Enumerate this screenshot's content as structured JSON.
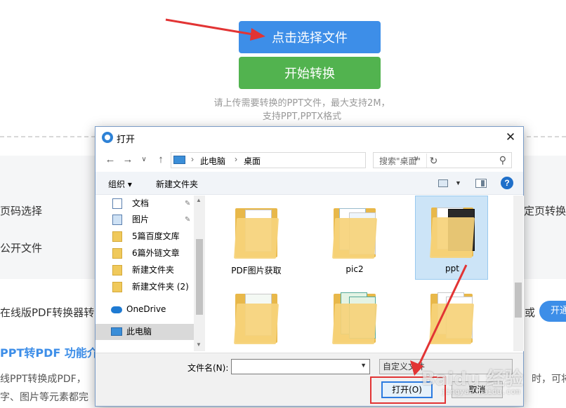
{
  "page": {
    "select_file_button": "点击选择文件",
    "start_convert_button": "开始转换",
    "hint_line1": "请上传需要转换的PPT文件，最大支持2M，",
    "hint_line2": "支持PPT,PPTX格式",
    "page_select_label": "页码选择",
    "open_file_label": "公开文件",
    "specify_page_label": "定页转换",
    "online_text": "在线版PDF转换器转",
    "or_text": "或",
    "open_small_button": "开通",
    "feature_title": "PPT转PDF 功能介",
    "desc_line1": "线PPT转换成PDF，",
    "desc_line2": "字、图片等元素都完",
    "desc_right1": "时，",
    "desc_right2": "可将"
  },
  "dialog": {
    "title": "打开",
    "close_glyph": "✕",
    "nav": {
      "back": "←",
      "forward": "→",
      "recent": "∨",
      "up": "↑",
      "path_root": "此电脑",
      "path_leaf": "桌面",
      "refresh": "↻",
      "search_placeholder": "搜索\"桌面\"",
      "search_icon": "search-icon"
    },
    "toolbar": {
      "organize": "组织 ▾",
      "new_folder": "新建文件夹",
      "help": "?"
    },
    "sidebar": {
      "items": [
        {
          "label": "文档",
          "icon": "document-icon",
          "pinned": true
        },
        {
          "label": "图片",
          "icon": "pictures-icon",
          "pinned": true
        },
        {
          "label": "5篇百度文库",
          "icon": "folder-icon"
        },
        {
          "label": "6篇外链文章",
          "icon": "folder-icon"
        },
        {
          "label": "新建文件夹",
          "icon": "folder-icon"
        },
        {
          "label": "新建文件夹 (2)",
          "icon": "folder-icon"
        },
        {
          "label": "OneDrive",
          "icon": "cloud-icon"
        },
        {
          "label": "此电脑",
          "icon": "computer-icon",
          "selected": true
        }
      ]
    },
    "files": [
      {
        "label": "PDF图片获取"
      },
      {
        "label": "pic2"
      },
      {
        "label": "ppt",
        "selected": true
      },
      {
        "label": ""
      },
      {
        "label": ""
      },
      {
        "label": ""
      }
    ],
    "footer": {
      "filename_label": "文件名(N):",
      "filename_value": "",
      "filetype": "自定义文件",
      "open_button": "打开(O)",
      "cancel_button": "取消"
    }
  },
  "watermark": {
    "brand": "Baidu 经验",
    "url": "jingyan.baidu.com"
  },
  "colors": {
    "primary_blue": "#3d8ee8",
    "green": "#52b34f",
    "annotation_red": "#e23434",
    "selection": "#cce4f7"
  }
}
